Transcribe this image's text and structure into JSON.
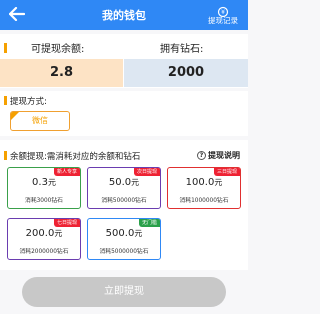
{
  "header": {
    "title": "我的钱包",
    "records_label": "提现记录"
  },
  "balance": {
    "withdrawable_label": "可提现余额:",
    "diamonds_label": "拥有钻石:",
    "withdrawable_value": "2.8",
    "diamonds_value": "2000"
  },
  "method": {
    "heading": "提现方式:",
    "option_label": "微信"
  },
  "amounts": {
    "heading": "余额提现:需消耗对应的余额和钻石",
    "explain_label": "提现说明",
    "options": [
      {
        "amount": "0.3",
        "unit": "元",
        "cost": "消耗3000钻石",
        "tag": "新人专享",
        "border_color": "#3aa04a",
        "tag_color": "#ee2233"
      },
      {
        "amount": "50.0",
        "unit": "元",
        "cost": "消耗500000钻石",
        "tag": "次日提现",
        "border_color": "#6a3db0",
        "tag_color": "#ee2233"
      },
      {
        "amount": "100.0",
        "unit": "元",
        "cost": "消耗1000000钻石",
        "tag": "三日提现",
        "border_color": "#e03030",
        "tag_color": "#ee2233"
      },
      {
        "amount": "200.0",
        "unit": "元",
        "cost": "消耗2000000钻石",
        "tag": "七日提现",
        "border_color": "#6a3db0",
        "tag_color": "#ee2233"
      },
      {
        "amount": "500.0",
        "unit": "元",
        "cost": "消耗5000000钻石",
        "tag": "无门槛",
        "border_color": "#2f88f5",
        "tag_color": "#2aa04a"
      }
    ]
  },
  "submit_label": "立即提现",
  "colors": {
    "primary": "#2f88f5",
    "accent": "#f5a000",
    "disabled": "#c8c8c8"
  }
}
